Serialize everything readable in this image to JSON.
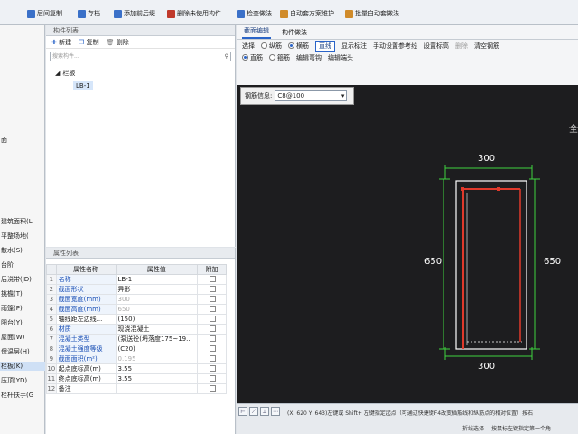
{
  "toolbar": {
    "items": [
      {
        "label": "层间复制",
        "icon": "copy-layers-icon",
        "color": "#3a70c8"
      },
      {
        "label": "存档",
        "icon": "save-icon",
        "color": "#3a70c8"
      },
      {
        "label": "添加前后缀",
        "icon": "add-affix-icon",
        "color": "#3a70c8"
      },
      {
        "label": "删除未使用构件",
        "icon": "delete-unused-icon",
        "color": "#c0392b"
      },
      {
        "label": "检查做法",
        "icon": "check-icon",
        "color": "#3a70c8"
      },
      {
        "label": "自动套方案维护",
        "icon": "auto-scheme-icon",
        "color": "#d08b2a"
      },
      {
        "label": "批量自动套做法",
        "icon": "batch-auto-icon",
        "color": "#d08b2a"
      }
    ]
  },
  "left_panel": {
    "items": [
      "面",
      "建筑面积(L",
      "平整场地(",
      "散水(S)",
      "台阶",
      "后浇带(JD)",
      "挑檐(T)",
      "雨篷(P)",
      "阳台(Y)",
      "屋面(W)",
      "保温层(H)",
      "栏板(K)",
      "压顶(YD)",
      "栏杆扶手(G"
    ]
  },
  "component_list": {
    "title": "构件列表",
    "new_label": "新建",
    "copy_label": "复制",
    "delete_label": "删除",
    "search_placeholder": "搜索构件...",
    "tree_root": "栏板",
    "tree_leaf": "LB-1"
  },
  "properties": {
    "title": "属性列表",
    "headers": {
      "name": "属性名称",
      "value": "属性值",
      "extra": "附加"
    },
    "rows": [
      {
        "idx": "1",
        "name": "名称",
        "value": "LB-1",
        "blue": true,
        "gray": false
      },
      {
        "idx": "2",
        "name": "截面形状",
        "value": "异形",
        "blue": true,
        "gray": false
      },
      {
        "idx": "3",
        "name": "截面宽度(mm)",
        "value": "300",
        "blue": true,
        "gray": true
      },
      {
        "idx": "4",
        "name": "截面高度(mm)",
        "value": "650",
        "blue": true,
        "gray": true
      },
      {
        "idx": "5",
        "name": "轴线距左边线...",
        "value": "(150)",
        "blue": false,
        "gray": false
      },
      {
        "idx": "6",
        "name": "材质",
        "value": "现浇混凝土",
        "blue": true,
        "gray": false
      },
      {
        "idx": "7",
        "name": "混凝土类型",
        "value": "(泵送砼(坍落度175~19...",
        "blue": true,
        "gray": false
      },
      {
        "idx": "8",
        "name": "混凝土强度等级",
        "value": "(C20)",
        "blue": true,
        "gray": false
      },
      {
        "idx": "9",
        "name": "截面面积(m²)",
        "value": "0.195",
        "blue": true,
        "gray": true
      },
      {
        "idx": "10",
        "name": "起点底标高(m)",
        "value": "3.55",
        "blue": false,
        "gray": false
      },
      {
        "idx": "11",
        "name": "终点底标高(m)",
        "value": "3.55",
        "blue": false,
        "gray": false
      },
      {
        "idx": "12",
        "name": "备注",
        "value": "",
        "blue": false,
        "gray": false
      }
    ]
  },
  "editor": {
    "tabs": [
      "截面编辑",
      "构件做法"
    ],
    "row1": {
      "select_label": "选择",
      "long_rebar": "纵筋",
      "stirrup": "横筋",
      "straight_line": "直线",
      "show_label": "显示标注",
      "manual_ref": "手动设置参考线",
      "set_origin": "设置标高",
      "delete": "删除",
      "clear_rebar": "清空钢筋"
    },
    "row2": {
      "straight": "直筋",
      "curved": "箍筋",
      "edit_hook": "编辑弯钩",
      "edit_end": "编辑端头"
    }
  },
  "canvas": {
    "rebar_info_label": "钢筋信息:",
    "rebar_info_value": "C8@100",
    "corner_text": "全",
    "dims": {
      "top": "300",
      "bottom": "300",
      "left": "650",
      "right": "650"
    }
  },
  "status": {
    "coords_text": "(X: 620 Y: 643)左键或 Shift+ 左键指定起点（可通过快捷键F4改变插筋线和纵筋点的相对位置）按右",
    "bottom_items": [
      "折线选择",
      "按鼠标左键指定第一个角"
    ]
  },
  "colors": {
    "rebar_red": "#e0392b",
    "dim_green": "#3fd23f",
    "outline_white": "#ffffff",
    "accent_blue": "#2a64c8"
  }
}
